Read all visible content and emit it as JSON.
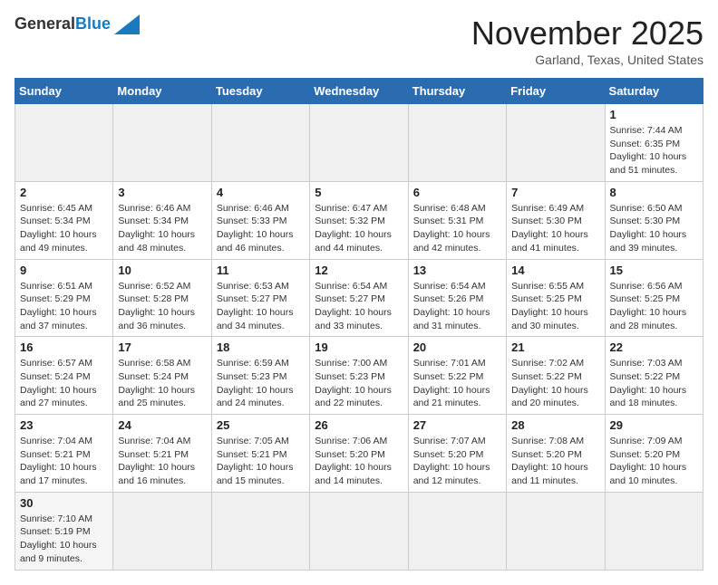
{
  "logo": {
    "general": "General",
    "blue": "Blue"
  },
  "header": {
    "month": "November 2025",
    "location": "Garland, Texas, United States"
  },
  "weekdays": [
    "Sunday",
    "Monday",
    "Tuesday",
    "Wednesday",
    "Thursday",
    "Friday",
    "Saturday"
  ],
  "weeks": [
    [
      {
        "day": "",
        "empty": true
      },
      {
        "day": "",
        "empty": true
      },
      {
        "day": "",
        "empty": true
      },
      {
        "day": "",
        "empty": true
      },
      {
        "day": "",
        "empty": true
      },
      {
        "day": "",
        "empty": true
      },
      {
        "day": "1",
        "sunrise": "7:44 AM",
        "sunset": "6:35 PM",
        "daylight": "10 hours and 51 minutes."
      }
    ],
    [
      {
        "day": "2",
        "sunrise": "6:45 AM",
        "sunset": "5:34 PM",
        "daylight": "10 hours and 49 minutes."
      },
      {
        "day": "3",
        "sunrise": "6:46 AM",
        "sunset": "5:34 PM",
        "daylight": "10 hours and 48 minutes."
      },
      {
        "day": "4",
        "sunrise": "6:46 AM",
        "sunset": "5:33 PM",
        "daylight": "10 hours and 46 minutes."
      },
      {
        "day": "5",
        "sunrise": "6:47 AM",
        "sunset": "5:32 PM",
        "daylight": "10 hours and 44 minutes."
      },
      {
        "day": "6",
        "sunrise": "6:48 AM",
        "sunset": "5:31 PM",
        "daylight": "10 hours and 42 minutes."
      },
      {
        "day": "7",
        "sunrise": "6:49 AM",
        "sunset": "5:30 PM",
        "daylight": "10 hours and 41 minutes."
      },
      {
        "day": "8",
        "sunrise": "6:50 AM",
        "sunset": "5:30 PM",
        "daylight": "10 hours and 39 minutes."
      }
    ],
    [
      {
        "day": "9",
        "sunrise": "6:51 AM",
        "sunset": "5:29 PM",
        "daylight": "10 hours and 37 minutes."
      },
      {
        "day": "10",
        "sunrise": "6:52 AM",
        "sunset": "5:28 PM",
        "daylight": "10 hours and 36 minutes."
      },
      {
        "day": "11",
        "sunrise": "6:53 AM",
        "sunset": "5:27 PM",
        "daylight": "10 hours and 34 minutes."
      },
      {
        "day": "12",
        "sunrise": "6:54 AM",
        "sunset": "5:27 PM",
        "daylight": "10 hours and 33 minutes."
      },
      {
        "day": "13",
        "sunrise": "6:54 AM",
        "sunset": "5:26 PM",
        "daylight": "10 hours and 31 minutes."
      },
      {
        "day": "14",
        "sunrise": "6:55 AM",
        "sunset": "5:25 PM",
        "daylight": "10 hours and 30 minutes."
      },
      {
        "day": "15",
        "sunrise": "6:56 AM",
        "sunset": "5:25 PM",
        "daylight": "10 hours and 28 minutes."
      }
    ],
    [
      {
        "day": "16",
        "sunrise": "6:57 AM",
        "sunset": "5:24 PM",
        "daylight": "10 hours and 27 minutes."
      },
      {
        "day": "17",
        "sunrise": "6:58 AM",
        "sunset": "5:24 PM",
        "daylight": "10 hours and 25 minutes."
      },
      {
        "day": "18",
        "sunrise": "6:59 AM",
        "sunset": "5:23 PM",
        "daylight": "10 hours and 24 minutes."
      },
      {
        "day": "19",
        "sunrise": "7:00 AM",
        "sunset": "5:23 PM",
        "daylight": "10 hours and 22 minutes."
      },
      {
        "day": "20",
        "sunrise": "7:01 AM",
        "sunset": "5:22 PM",
        "daylight": "10 hours and 21 minutes."
      },
      {
        "day": "21",
        "sunrise": "7:02 AM",
        "sunset": "5:22 PM",
        "daylight": "10 hours and 20 minutes."
      },
      {
        "day": "22",
        "sunrise": "7:03 AM",
        "sunset": "5:22 PM",
        "daylight": "10 hours and 18 minutes."
      }
    ],
    [
      {
        "day": "23",
        "sunrise": "7:04 AM",
        "sunset": "5:21 PM",
        "daylight": "10 hours and 17 minutes."
      },
      {
        "day": "24",
        "sunrise": "7:04 AM",
        "sunset": "5:21 PM",
        "daylight": "10 hours and 16 minutes."
      },
      {
        "day": "25",
        "sunrise": "7:05 AM",
        "sunset": "5:21 PM",
        "daylight": "10 hours and 15 minutes."
      },
      {
        "day": "26",
        "sunrise": "7:06 AM",
        "sunset": "5:20 PM",
        "daylight": "10 hours and 14 minutes."
      },
      {
        "day": "27",
        "sunrise": "7:07 AM",
        "sunset": "5:20 PM",
        "daylight": "10 hours and 12 minutes."
      },
      {
        "day": "28",
        "sunrise": "7:08 AM",
        "sunset": "5:20 PM",
        "daylight": "10 hours and 11 minutes."
      },
      {
        "day": "29",
        "sunrise": "7:09 AM",
        "sunset": "5:20 PM",
        "daylight": "10 hours and 10 minutes."
      }
    ],
    [
      {
        "day": "30",
        "sunrise": "7:10 AM",
        "sunset": "5:19 PM",
        "daylight": "10 hours and 9 minutes."
      },
      {
        "day": "",
        "empty": true
      },
      {
        "day": "",
        "empty": true
      },
      {
        "day": "",
        "empty": true
      },
      {
        "day": "",
        "empty": true
      },
      {
        "day": "",
        "empty": true
      },
      {
        "day": "",
        "empty": true
      }
    ]
  ]
}
